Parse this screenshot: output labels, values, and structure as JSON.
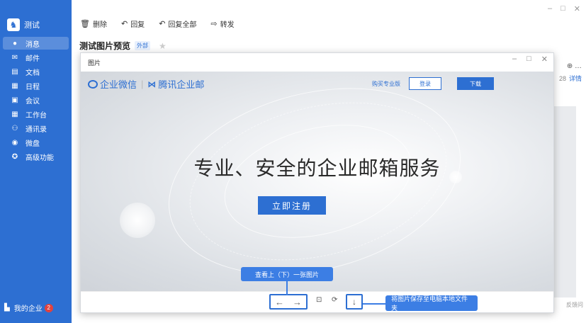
{
  "window": {
    "controls": [
      "–",
      "□",
      "✕"
    ]
  },
  "sidebar": {
    "org_name": "测试",
    "items": [
      {
        "label": "消息",
        "icon": "chat-bubble-icon",
        "glyph": "●",
        "active": true
      },
      {
        "label": "邮件",
        "icon": "mail-icon",
        "glyph": "✉",
        "active": false
      },
      {
        "label": "文档",
        "icon": "document-icon",
        "glyph": "▤",
        "active": false
      },
      {
        "label": "日程",
        "icon": "calendar-icon",
        "glyph": "▦",
        "active": false
      },
      {
        "label": "会议",
        "icon": "meeting-icon",
        "glyph": "▣",
        "active": false
      },
      {
        "label": "工作台",
        "icon": "workbench-icon",
        "glyph": "▦",
        "active": false
      },
      {
        "label": "通讯录",
        "icon": "contacts-icon",
        "glyph": "⚇",
        "active": false
      },
      {
        "label": "微盘",
        "icon": "drive-icon",
        "glyph": "◉",
        "active": false
      },
      {
        "label": "高级功能",
        "icon": "advanced-icon",
        "glyph": "✪",
        "active": false
      }
    ],
    "bottom_label": "我的企业",
    "bottom_badge": "2"
  },
  "toolbar": {
    "delete_label": "删除",
    "reply_label": "回复",
    "reply_all_label": "回复全部",
    "forward_label": "转发"
  },
  "mail": {
    "subject": "测试图片预览",
    "tag": "外部"
  },
  "background_right": {
    "more": "⊕ …",
    "count": "28",
    "detail": "详情",
    "date": "反馈问"
  },
  "preview": {
    "title": "图片",
    "controls": [
      "–",
      "□",
      "✕"
    ],
    "image": {
      "brand_wework": "企业微信",
      "brand_sep": "|",
      "brand_tencent": "腾讯企业邮",
      "buy_label": "购买专业版",
      "login_label": "登录",
      "download_label": "下载",
      "slogan": "专业、安全的企业邮箱服务",
      "register_label": "立即注册"
    },
    "bar": {
      "prev_glyph": "←",
      "next_glyph": "→",
      "original_glyph": "⊡",
      "rotate_glyph": "⟳",
      "save_glyph": "↓"
    }
  },
  "callouts": {
    "nav_tip": "查看上（下）一张图片",
    "save_tip": "将图片保存至电脑本地文件夹"
  }
}
